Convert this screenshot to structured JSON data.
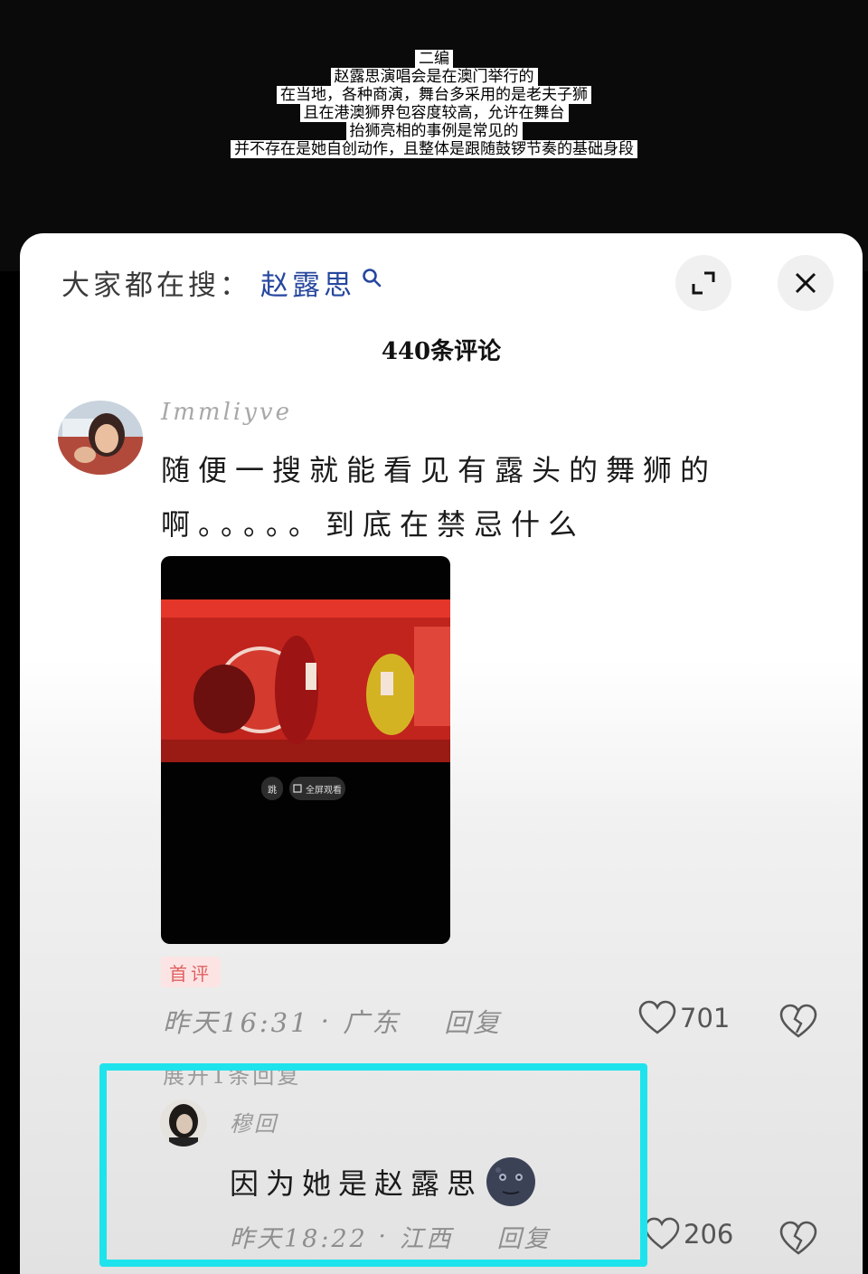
{
  "video": {
    "caption_lines": [
      "二编",
      "赵露思演唱会是在澳门举行的",
      "在当地，各种商演，舞台多采用的是老夫子狮",
      "且在港澳狮界包容度较高，允许在舞台",
      "抬狮亮相的事例是常见的",
      "并不存在是她自创动作，且整体是跟随鼓锣节奏的基础身段"
    ]
  },
  "sheet": {
    "search_prefix": "大家都在搜：",
    "search_term": "赵露思",
    "title": "440条评论"
  },
  "comments": [
    {
      "username": "Immliyve",
      "text": "随便一搜就能看见有露头的舞狮的啊。。。。。到底在禁忌什么",
      "tag": "首评",
      "time": "昨天16:31",
      "location": "广东",
      "reply_label": "回复",
      "likes": "701",
      "video_thumb": {
        "pill_small": "跳",
        "pill_wide": "全屏观看"
      }
    },
    {
      "username": "穆回",
      "text": "因为她是赵露思",
      "time": "昨天18:22",
      "location": "江西",
      "reply_label": "回复",
      "likes": "206"
    }
  ],
  "expand_text": "展开1条回复",
  "colors": {
    "search_term": "#27479e",
    "highlight": "#1fe3ec",
    "tag_bg": "#fde4e4",
    "tag_text": "#e06060"
  }
}
